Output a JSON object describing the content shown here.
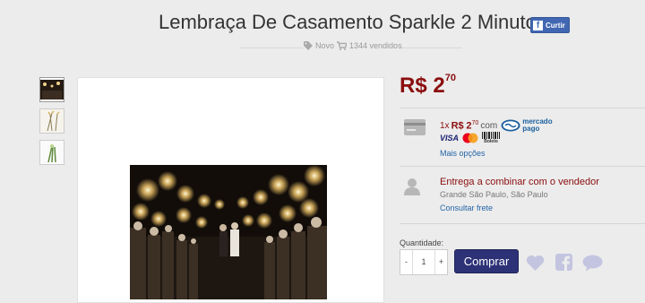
{
  "product": {
    "title": "Lembraça De Casamento Sparkle 2 Minutos",
    "condition": "Novo",
    "sold": "1344 vendidos"
  },
  "facebook": {
    "like_label": "Curtir",
    "icon_letter": "f"
  },
  "price": {
    "currency": "R$",
    "integer": "2",
    "cents": "70"
  },
  "payment": {
    "installments": "1x",
    "currency": "R$",
    "integer": "2",
    "cents": "70",
    "with": "com",
    "mp_line1": "mercado",
    "mp_line2": "pago",
    "card_visa": "VISA",
    "boleto": "Boleto",
    "more_link": "Mais opções"
  },
  "shipping": {
    "title": "Entrega a combinar com o vendedor",
    "location": "Grande São Paulo, São Paulo",
    "link": "Consultar frete"
  },
  "purchase": {
    "qty_label": "Quantidade:",
    "minus": "-",
    "qty": "1",
    "plus": "+",
    "buy_label": "Comprar"
  },
  "icons": [
    "tag-icon",
    "cart-icon",
    "credit-card-icon",
    "user-icon",
    "heart-icon",
    "facebook-icon",
    "speech-bubble-icon"
  ],
  "colors": {
    "price": "#8b0e0e",
    "link": "#2464a8",
    "buy_button": "#2d3277",
    "facebook": "#4267b2",
    "social_icons": "#c3c5e0"
  }
}
